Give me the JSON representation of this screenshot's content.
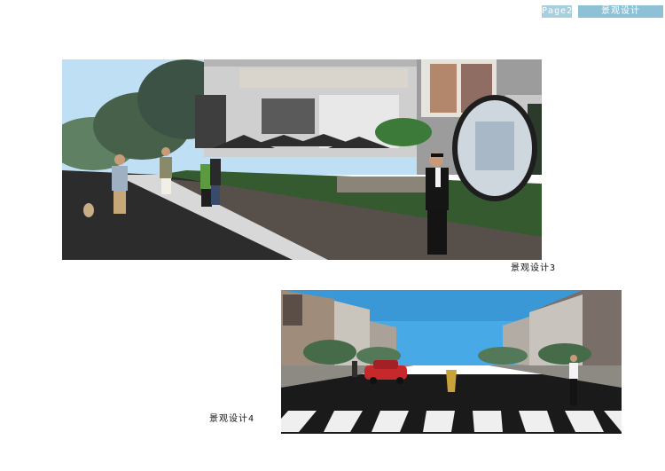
{
  "header": {
    "page_label": "Page22",
    "section_title": "景观设计"
  },
  "figures": [
    {
      "caption": "景观设计3"
    },
    {
      "caption": "景观设计4"
    }
  ]
}
